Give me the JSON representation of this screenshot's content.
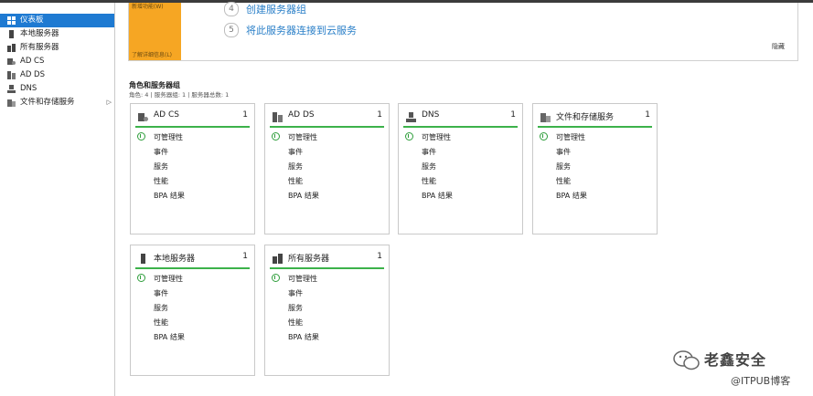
{
  "sidebar": {
    "items": [
      {
        "label": "仪表板",
        "icon": "dashboard-icon",
        "active": true
      },
      {
        "label": "本地服务器",
        "icon": "server-icon"
      },
      {
        "label": "所有服务器",
        "icon": "servers-icon"
      },
      {
        "label": "AD CS",
        "icon": "adcs-icon"
      },
      {
        "label": "AD DS",
        "icon": "adds-icon"
      },
      {
        "label": "DNS",
        "icon": "dns-icon"
      },
      {
        "label": "文件和存储服务",
        "icon": "file-storage-icon",
        "has_arrow": true,
        "arrow": "▷"
      }
    ]
  },
  "welcome": {
    "orange_top": "新增功能(W)",
    "orange_bottom": "了解详细信息(L)",
    "steps": [
      {
        "num": "4",
        "label": "创建服务器组"
      },
      {
        "num": "5",
        "label": "将此服务器连接到云服务"
      }
    ],
    "hide": "隐藏"
  },
  "roles": {
    "title": "角色和服务器组",
    "subtitle": "角色: 4 | 服务器组: 1 | 服务器总数: 1",
    "tiles": [
      {
        "name": "AD CS",
        "count": "1",
        "icon": "adcs-icon",
        "rows": [
          "可管理性",
          "事件",
          "服务",
          "性能",
          "BPA 结果"
        ]
      },
      {
        "name": "AD DS",
        "count": "1",
        "icon": "adds-icon",
        "rows": [
          "可管理性",
          "事件",
          "服务",
          "性能",
          "BPA 结果"
        ]
      },
      {
        "name": "DNS",
        "count": "1",
        "icon": "dns-icon",
        "rows": [
          "可管理性",
          "事件",
          "服务",
          "性能",
          "BPA 结果"
        ]
      },
      {
        "name": "文件和存储服务",
        "count": "1",
        "icon": "file-storage-icon",
        "rows": [
          "可管理性",
          "事件",
          "服务",
          "性能",
          "BPA 结果"
        ]
      },
      {
        "name": "本地服务器",
        "count": "1",
        "icon": "server-icon",
        "rows": [
          "可管理性",
          "事件",
          "服务",
          "性能",
          "BPA 结果"
        ]
      },
      {
        "name": "所有服务器",
        "count": "1",
        "icon": "servers-icon",
        "rows": [
          "可管理性",
          "事件",
          "服务",
          "性能",
          "BPA 结果"
        ]
      }
    ]
  },
  "watermark": {
    "brand": "老鑫安全",
    "sub": "@ITPUB博客"
  },
  "colors": {
    "accent": "#1e7ad2",
    "orange": "#f6a623",
    "ok_green": "#3cb24a",
    "link": "#2a7fc8"
  }
}
